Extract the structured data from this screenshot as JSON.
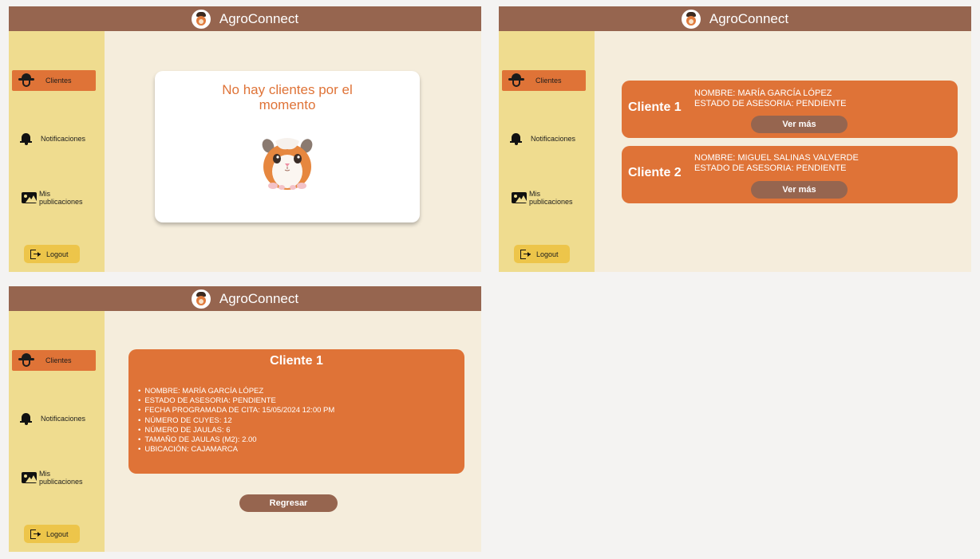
{
  "app": {
    "title": "AgroConnect"
  },
  "sidebar": {
    "items": [
      {
        "label": "Clientes",
        "icon": "farmer-icon"
      },
      {
        "label": "Notificaciones",
        "icon": "bell-icon"
      },
      {
        "label": "Mis publicaciones",
        "icon": "image-icon"
      }
    ],
    "logout_label": "Logout"
  },
  "empty_state": {
    "message_line1": "No hay clientes por el",
    "message_line2": "momento"
  },
  "clients": [
    {
      "title": "Cliente 1",
      "nombre": "NOMBRE: MARÍA GARCÍA LÓPEZ",
      "estado": "ESTADO DE ASESORIA: PENDIENTE",
      "button": "Ver más"
    },
    {
      "title": "Cliente 2",
      "nombre": "NOMBRE: MIGUEL SALINAS VALVERDE",
      "estado": "ESTADO DE ASESORIA: PENDIENTE",
      "button": "Ver más"
    }
  ],
  "detail": {
    "title": "Cliente 1",
    "items": [
      "NOMBRE: MARÍA GARCÍA LÓPEZ",
      "ESTADO DE ASESORIA: PENDIENTE",
      "FECHA PROGRAMADA DE CITA: 15/05/2024 12:00 PM",
      "NÚMERO DE CUYES: 12",
      "NÚMERO DE JAULAS: 6",
      "TAMAÑO DE JAULAS (M2): 2.00",
      "UBICACIÓN: CAJAMARCA"
    ],
    "back_button": "Regresar"
  },
  "colors": {
    "topbar": "#96654f",
    "sidebar": "#efdc8f",
    "content_bg": "#f5eddc",
    "accent": "#df7337",
    "logout": "#edc54a",
    "canvas": "#f4f3f2"
  }
}
